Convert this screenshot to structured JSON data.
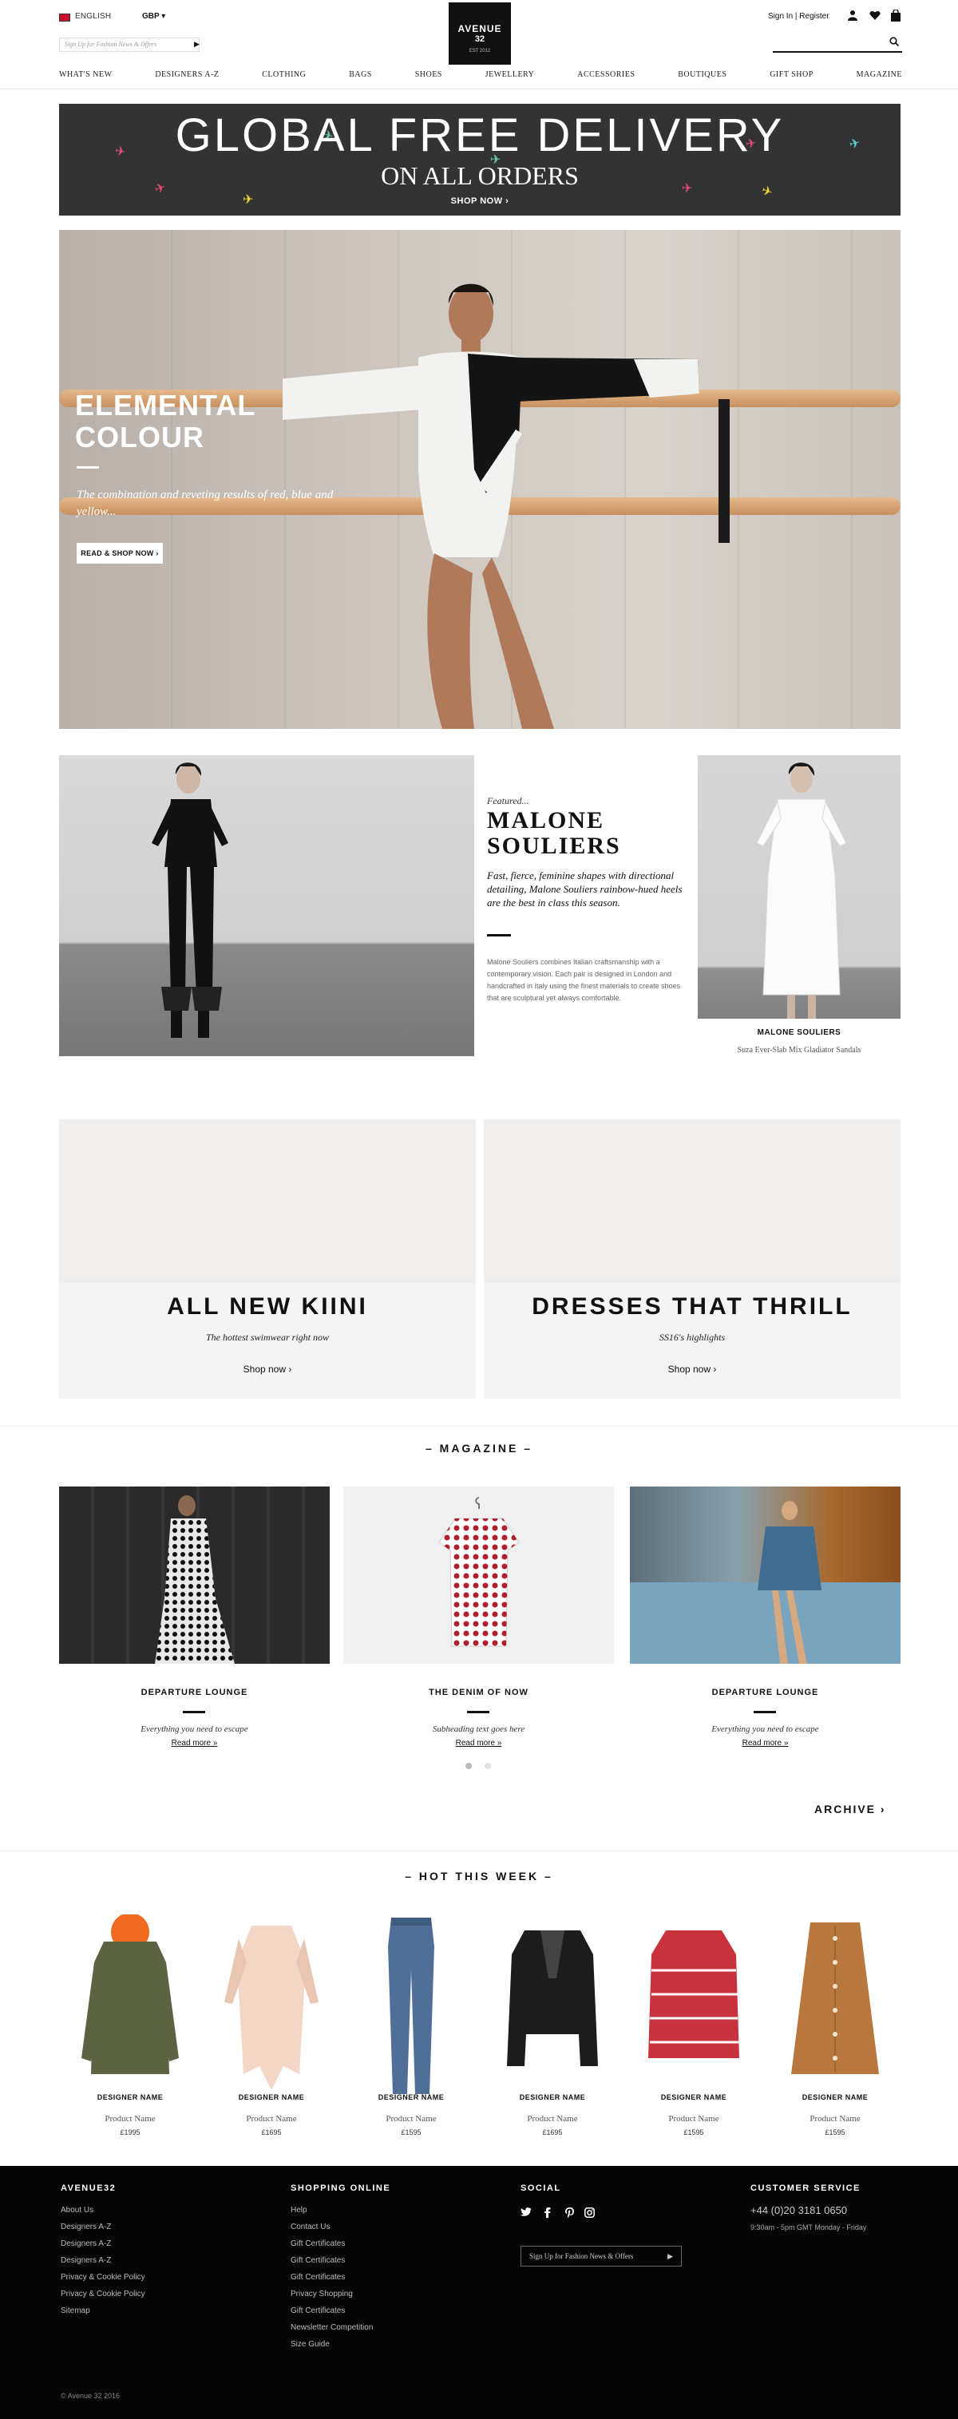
{
  "header": {
    "language": "ENGLISH",
    "currency": "GBP",
    "signup_placeholder": "Sign Up for Fashion News & Offers",
    "logo_line1": "AVENUE",
    "logo_line2": "32",
    "logo_line3": "EST 2012",
    "signin": "Sign In | Register",
    "nav": [
      "What's New",
      "Designers A-Z",
      "Clothing",
      "Bags",
      "Shoes",
      "Jewellery",
      "Accessories",
      "Boutiques",
      "Gift Shop",
      "Magazine"
    ]
  },
  "banner": {
    "headline": "GLOBAL FREE DELIVERY",
    "subheadline": "ON ALL ORDERS",
    "cta": "SHOP NOW ›"
  },
  "hero": {
    "title": "ELEMENTAL COLOUR",
    "description": "The combination and reveting results of red, blue and yellow...",
    "cta": "READ & SHOP NOW ›"
  },
  "featured": {
    "kicker": "Featured...",
    "title": "MALONE SOULIERS",
    "description": "Fast, fierce, feminine shapes with directional detailing, Malone Souliers rainbow-hued heels are the best in class this season.",
    "body": "Malone Souliers combines Italian craftsmanship with a contemporary vision. Each pair is designed in London and handcrafted in Italy using the finest materials to create shoes that are sculptural yet always comfortable.",
    "brand": "MALONE SOULIERS",
    "product": "Suza Ever-Slab Mix Gladiator Sandals"
  },
  "promos": [
    {
      "title": "ALL NEW KIINI",
      "subtitle": "The hottest swimwear right now",
      "link": "Shop now ›"
    },
    {
      "title": "DRESSES THAT THRILL",
      "subtitle": "SS16's highlights",
      "link": "Shop now ›"
    }
  ],
  "magazine": {
    "title": "– MAGAZINE –",
    "articles": [
      {
        "title": "DEPARTURE LOUNGE",
        "desc": "Everything you need to escape",
        "more": "Read more »"
      },
      {
        "title": "THE DENIM OF NOW",
        "desc": "Subheading text goes here",
        "more": "Read more »"
      },
      {
        "title": "DEPARTURE LOUNGE",
        "desc": "Everything you need to escape",
        "more": "Read more »"
      }
    ],
    "archive": "ARCHIVE ›"
  },
  "hot": {
    "title": "– HOT THIS WEEK –",
    "products": [
      {
        "designer": "DESIGNER NAME",
        "name": "Product Name",
        "price": "£1995",
        "color": "#5b6343",
        "accent": "#f06a1f"
      },
      {
        "designer": "DESIGNER NAME",
        "name": "Product Name",
        "price": "£1695",
        "color": "#f3d6c5",
        "accent": "#e9c6b1"
      },
      {
        "designer": "DESIGNER NAME",
        "name": "Product Name",
        "price": "£1595",
        "color": "#4f6f98",
        "accent": "#3e5b80"
      },
      {
        "designer": "DESIGNER NAME",
        "name": "Product Name",
        "price": "£1695",
        "color": "#1c1c1c",
        "accent": "#444444"
      },
      {
        "designer": "DESIGNER NAME",
        "name": "Product Name",
        "price": "£1595",
        "color": "#c8323c",
        "accent": "#ffffff"
      },
      {
        "designer": "DESIGNER NAME",
        "name": "Product Name",
        "price": "£1595",
        "color": "#b8773c",
        "accent": "#a3652d"
      }
    ]
  },
  "footer": {
    "col1": {
      "title": "AVENUE32",
      "links": [
        "About Us",
        "Designers A-Z",
        "Designers A-Z",
        "Designers A-Z",
        "Privacy & Cookie Policy",
        "Privacy & Cookie Policy",
        "Sitemap"
      ]
    },
    "col2": {
      "title": "SHOPPING ONLINE",
      "links": [
        "Help",
        "Contact Us",
        "Gift Certificates",
        "Gift Certificates",
        "Gift Certificates",
        "Privacy Shopping",
        "Gift Certificates",
        "Newsletter Competition",
        "Size Guide"
      ]
    },
    "col3": {
      "title": "SOCIAL",
      "newsletter": "Sign Up for Fashion News & Offers"
    },
    "col4": {
      "title": "CUSTOMER SERVICE",
      "phone": "+44 (0)20 3181 0650",
      "hours": "9:30am - 5pm GMT Monday - Friday"
    },
    "copyright": "© Avenue 32 2016"
  }
}
